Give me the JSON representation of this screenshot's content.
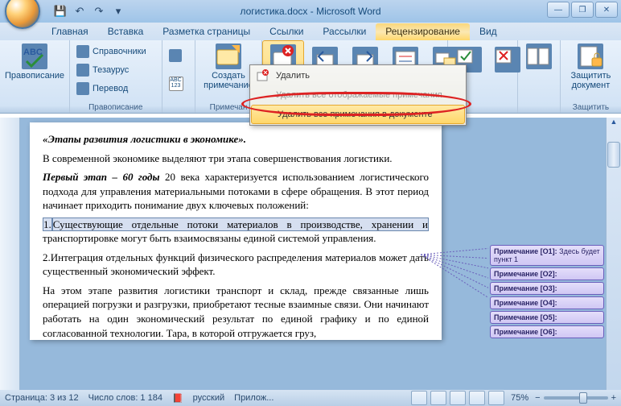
{
  "title": "логистика.docx - Microsoft Word",
  "qa": [
    "save",
    "undo",
    "redo",
    "dropdown"
  ],
  "tabs": [
    "Главная",
    "Вставка",
    "Разметка страницы",
    "Ссылки",
    "Рассылки",
    "Рецензирование",
    "Вид"
  ],
  "active_tab": 5,
  "ribbon": {
    "proofing": {
      "spelling": "Правописание",
      "research": "Справочники",
      "thesaurus": "Тезаурус",
      "translate": "Перевод",
      "group_title": "Правописание"
    },
    "comments": {
      "new_comment": "Создать\nпримечание",
      "group_title": "Примечан"
    },
    "protect": {
      "protect_doc": "Защитить\nдокумент",
      "group_title": "Защитить"
    }
  },
  "dropdown": {
    "delete": "Удалить",
    "delete_shown": "Удалить все отображаемые примечания",
    "delete_all": "Удалить все примечания в документе"
  },
  "doc": {
    "h": "«Этапы развития логистики в экономике».",
    "p1": "В современной экономике выделяют три этапа совершенствования логистики.",
    "p2a": "Первый этап – 60 годы",
    "p2b": " 20 века характеризуется использованием логистического подхода для управления материальными потоками в сфере обращения. В этот период начинает приходить понимание двух ключевых положений:",
    "li1a": "1.",
    "li1b": "Существующие отдельные потоки материалов в производстве, хранении и",
    "li1c": " транспортировке могут быть взаимосвязаны единой системой управления.",
    "li2": "2.Интеграция отдельных функций физического распределения материалов может дать существенный экономический эффект.",
    "p3": "На этом этапе развития логистики транспорт и склад, прежде связанные лишь операцией погрузки и разгрузки, приобретают тесные взаимные связи. Они начинают работать на один экономический результат по единой графику и по единой согласованной технологии. Тара, в которой отгружается груз,"
  },
  "comments": [
    {
      "label": "Примечание [О1]:",
      "text": "Здесь будет пункт 1"
    },
    {
      "label": "Примечание [О2]:",
      "text": ""
    },
    {
      "label": "Примечание [О3]:",
      "text": ""
    },
    {
      "label": "Примечание [О4]:",
      "text": ""
    },
    {
      "label": "Примечание [О5]:",
      "text": ""
    },
    {
      "label": "Примечание [О6]:",
      "text": ""
    }
  ],
  "status": {
    "page": "Страница: 3 из 12",
    "words": "Число слов: 1 184",
    "lang": "русский",
    "insert": "Прилож...",
    "zoom": "75%"
  }
}
